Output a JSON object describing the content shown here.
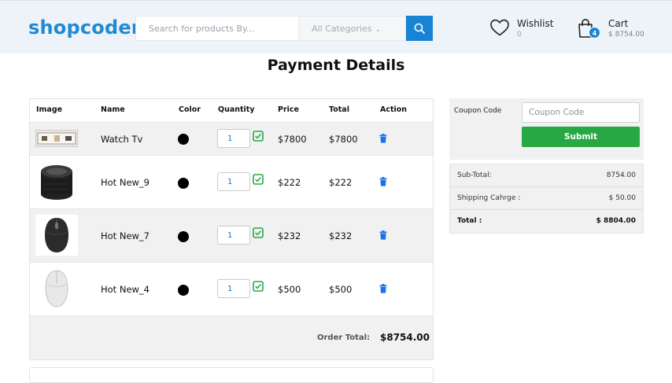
{
  "header": {
    "logo": "shopcoder",
    "search_placeholder": "Search for products By...",
    "category_label": "All Categories",
    "wishlist_label": "Wishlist",
    "wishlist_count": "0",
    "cart_label": "Cart",
    "cart_amount": "$ 8754.00",
    "cart_badge": "4",
    "accent_color": "#1783d5"
  },
  "page": {
    "title": "Payment Details"
  },
  "cart_table": {
    "columns": [
      "Image",
      "Name",
      "Color",
      "Quantity",
      "Price",
      "Total",
      "Action"
    ],
    "rows": [
      {
        "name": "Watch Tv",
        "color": "#000000",
        "quantity": "1",
        "price": "$7800",
        "total": "$7800",
        "image": "watch-tv-thumbnail"
      },
      {
        "name": "Hot New_9",
        "color": "#000000",
        "quantity": "1",
        "price": "$222",
        "total": "$222",
        "image": "speaker-thumbnail"
      },
      {
        "name": "Hot New_7",
        "color": "#000000",
        "quantity": "1",
        "price": "$232",
        "total": "$232",
        "image": "black-mouse-thumbnail"
      },
      {
        "name": "Hot New_4",
        "color": "#000000",
        "quantity": "1",
        "price": "$500",
        "total": "$500",
        "image": "white-mouse-thumbnail"
      }
    ],
    "order_total_label": "Order Total:",
    "order_total_value": "$8754.00"
  },
  "coupon": {
    "label": "Coupon Code",
    "placeholder": "Coupon Code",
    "submit_label": "Submit",
    "submit_color": "#27a844"
  },
  "summary": {
    "subtotal_label": "Sub-Total:",
    "subtotal_value": "8754.00",
    "shipping_label": "Shipping Cahrge :",
    "shipping_value": "$ 50.00",
    "total_label": "Total :",
    "total_value": "$ 8804.00"
  }
}
